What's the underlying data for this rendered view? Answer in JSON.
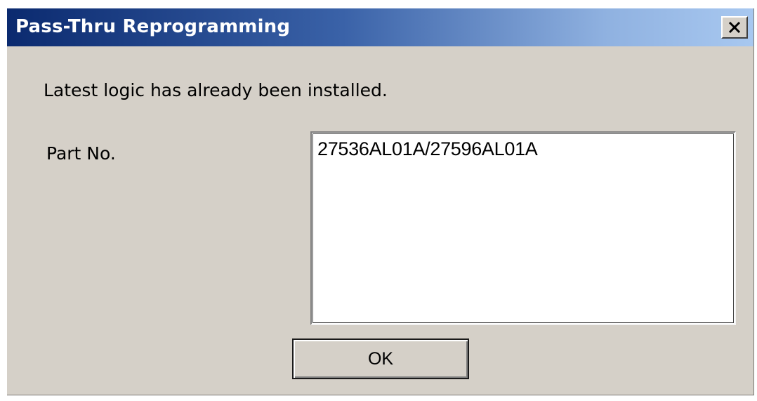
{
  "window": {
    "title": "Pass-Thru Reprogramming",
    "close_icon": "close-x-icon"
  },
  "dialog": {
    "message": "Latest logic has already been installed.",
    "part_label": "Part No.",
    "part_value": "27536AL01A/27596AL01A",
    "ok_label": "OK"
  },
  "colors": {
    "title_gradient_start": "#0b2a6f",
    "title_gradient_end": "#a8c8f0",
    "dialog_background": "#d5d0c8"
  }
}
